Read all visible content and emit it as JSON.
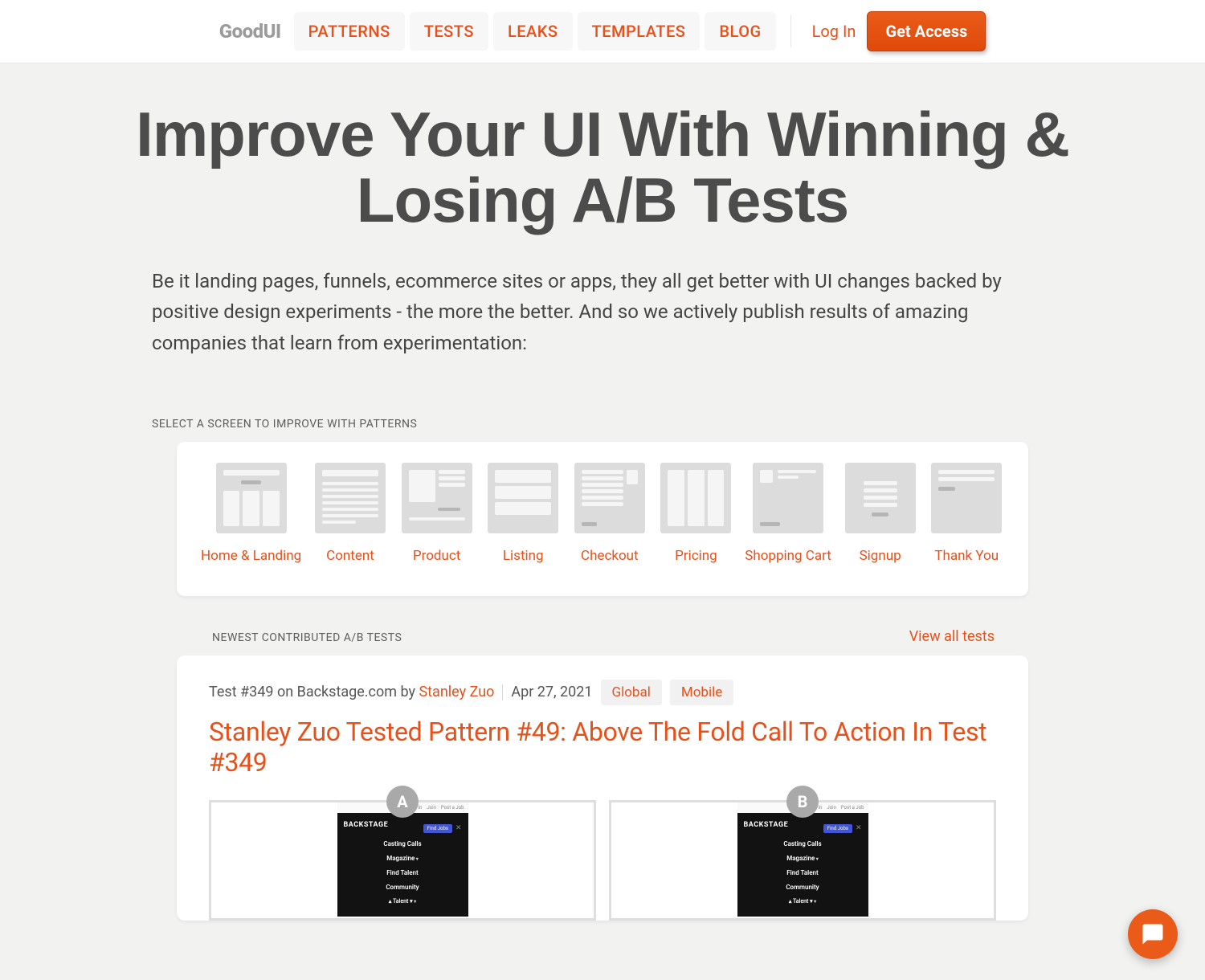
{
  "header": {
    "logo": "GoodUI",
    "nav": [
      "PATTERNS",
      "TESTS",
      "LEAKS",
      "TEMPLATES",
      "BLOG"
    ],
    "login": "Log In",
    "cta": "Get Access"
  },
  "hero": {
    "title": "Improve Your UI With Winning & Losing A/B Tests",
    "lead": "Be it landing pages, funnels, ecommerce sites or apps, they all get better with UI changes backed by positive design experiments - the more the better. And so we actively publish results of amazing companies that learn from experimentation:"
  },
  "screens": {
    "label": "SELECT A SCREEN TO IMPROVE WITH PATTERNS",
    "items": [
      "Home & Landing",
      "Content",
      "Product",
      "Listing",
      "Checkout",
      "Pricing",
      "Shopping Cart",
      "Signup",
      "Thank You"
    ]
  },
  "tests": {
    "label": "NEWEST CONTRIBUTED A/B TESTS",
    "viewall": "View all tests",
    "item": {
      "prefix": "Test #349 on Backstage.com by ",
      "author": "Stanley Zuo",
      "date": "Apr 27, 2021",
      "tags": [
        "Global",
        "Mobile"
      ],
      "title": "Stanley Zuo Tested Pattern #49: Above The Fold Call To Action In Test #349",
      "variants": {
        "a": "A",
        "b": "B"
      },
      "mock": {
        "topnav": [
          "Sign In",
          "Join",
          "Post a Job"
        ],
        "brand": "BACKSTAGE",
        "btn": "Find Jobs",
        "links": [
          "Casting Calls",
          "Magazine",
          "Find Talent",
          "Community",
          "Talent"
        ]
      }
    }
  }
}
